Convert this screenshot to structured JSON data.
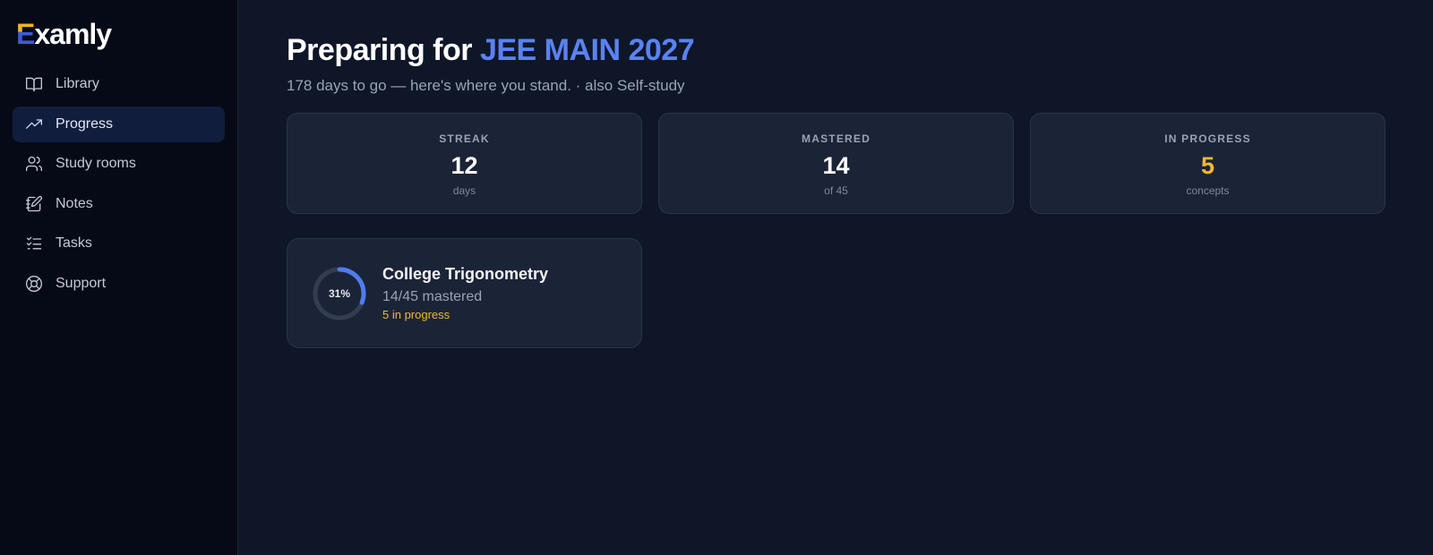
{
  "brand": {
    "logo_mark": "E",
    "logo_rest": "xamly",
    "accent": "#f2b51c",
    "accent2": "#3b5bdb"
  },
  "sidebar": {
    "items": [
      {
        "label": "Library",
        "icon": "book-icon",
        "active": false
      },
      {
        "label": "Progress",
        "icon": "trending-up-icon",
        "active": true
      },
      {
        "label": "Study rooms",
        "icon": "users-icon",
        "active": false
      },
      {
        "label": "Notes",
        "icon": "notes-icon",
        "active": false
      },
      {
        "label": "Tasks",
        "icon": "checklist-icon",
        "active": false
      },
      {
        "label": "Support",
        "icon": "lifebuoy-icon",
        "active": false
      }
    ]
  },
  "header": {
    "title_prefix": "Preparing for ",
    "title_exam": "JEE MAIN 2027",
    "subtitle": "178 days to go — here's where you stand. · also Self-study"
  },
  "stats": [
    {
      "label": "STREAK",
      "value": "12",
      "unit": "days",
      "color": "#ffffff"
    },
    {
      "label": "MASTERED",
      "value": "14",
      "unit": "of 45",
      "color": "#ffffff"
    },
    {
      "label": "IN PROGRESS",
      "value": "5",
      "unit": "concepts",
      "color": "#f5b82e"
    }
  ],
  "course": {
    "title": "College Trigonometry",
    "percent_label": "31%",
    "percent": 0.31,
    "mastered_text": "14/45 mastered",
    "in_progress_text": "5 in progress",
    "ring_color": "#4f7cf0"
  }
}
